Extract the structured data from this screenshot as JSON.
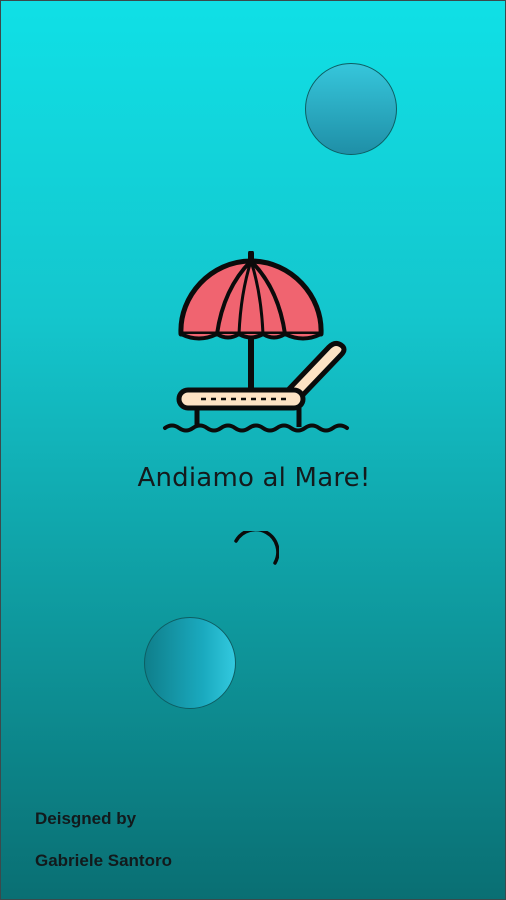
{
  "screen": {
    "title": "Andiamo al Mare!",
    "illustration_icon": "beach-umbrella-lounger-icon",
    "loading_indicator": "spinner-icon"
  },
  "credits": {
    "label": "Deisgned by",
    "name": "Gabriele Santoro"
  },
  "colors": {
    "background_top": "#10e0e6",
    "background_bottom": "#0a6f73",
    "umbrella": "#f06470",
    "lounger": "#fde2c4",
    "outline": "#0b0b0b",
    "text": "#141a1c"
  }
}
